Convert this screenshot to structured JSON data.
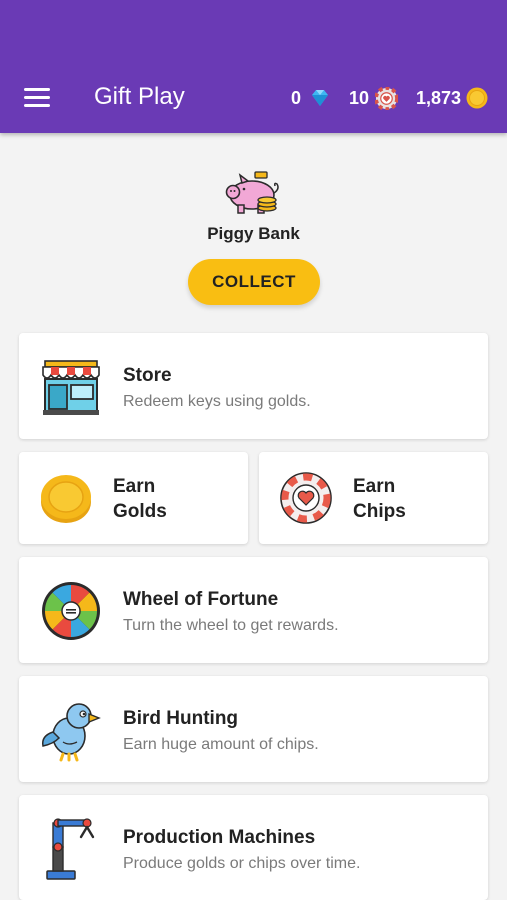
{
  "app": {
    "title": "Gift Play"
  },
  "header": {
    "gems": "0",
    "chips": "10",
    "golds": "1,873",
    "icons": [
      "menu-icon",
      "diamond-icon",
      "casino-chip-icon",
      "gold-coin-icon"
    ]
  },
  "piggy": {
    "label": "Piggy Bank",
    "collect_label": "COLLECT"
  },
  "cards": {
    "store": {
      "title": "Store",
      "subtitle": "Redeem keys using golds.",
      "icon": "storefront-icon"
    },
    "earn_golds": {
      "title_line1": "Earn",
      "title_line2": "Golds",
      "icon": "gold-coin-icon"
    },
    "earn_chips": {
      "title_line1": "Earn",
      "title_line2": "Chips",
      "icon": "casino-chip-icon"
    },
    "wheel": {
      "title": "Wheel of Fortune",
      "subtitle": "Turn the wheel to get rewards.",
      "icon": "fortune-wheel-icon"
    },
    "bird": {
      "title": "Bird Hunting",
      "subtitle": "Earn huge amount of chips.",
      "icon": "bird-icon"
    },
    "machines": {
      "title": "Production Machines",
      "subtitle": "Produce golds or chips over time.",
      "icon": "robot-arm-icon"
    }
  },
  "colors": {
    "appbar": "#6a3ab5",
    "accent": "#f9be12",
    "background": "#f3f3f3",
    "card": "#ffffff"
  }
}
